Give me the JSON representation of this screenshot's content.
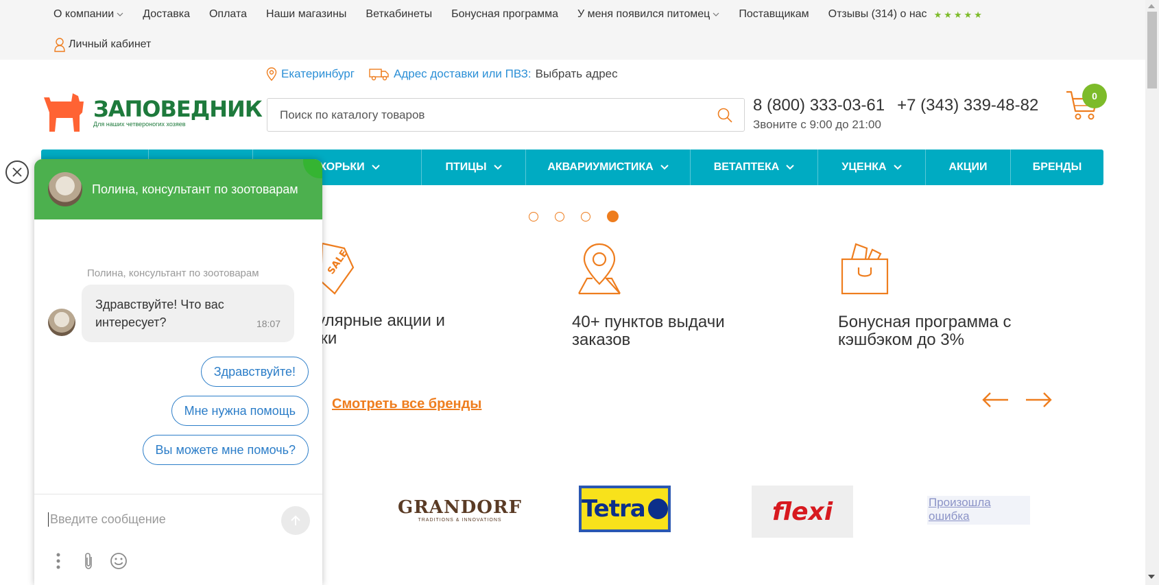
{
  "topnav": {
    "items": [
      {
        "label": "О компании",
        "has_dropdown": true
      },
      {
        "label": "Доставка",
        "has_dropdown": false
      },
      {
        "label": "Оплата",
        "has_dropdown": false
      },
      {
        "label": "Наши магазины",
        "has_dropdown": false
      },
      {
        "label": "Веткабинеты",
        "has_dropdown": false
      },
      {
        "label": "Бонусная программа",
        "has_dropdown": false
      },
      {
        "label": "У меня появился питомец",
        "has_dropdown": true
      },
      {
        "label": "Поставщикам",
        "has_dropdown": false
      },
      {
        "label": "Отзывы (314) о нас",
        "has_dropdown": false
      }
    ],
    "rating_stars": 5,
    "cabinet_label": "Личный кабинет"
  },
  "header": {
    "city": "Екатеринбург",
    "delivery_label": "Адрес доставки или ПВЗ:",
    "delivery_value": "Выбрать адрес",
    "logo_name": "ЗАПОВЕДНИК",
    "logo_tagline": "Для наших четвероногих хозяев",
    "search_placeholder": "Поиск по каталогу товаров",
    "phone_1": "8 (800) 333-03-61",
    "phone_2": "+7 (343) 339-48-82",
    "hours": "Звоните с 9:00 до 21:00",
    "cart_count": "0"
  },
  "categories": [
    {
      "label": "",
      "has_dropdown": false
    },
    {
      "label": "",
      "has_dropdown": false
    },
    {
      "label": "НЫ, ХОРЬКИ",
      "has_dropdown": true
    },
    {
      "label": "ПТИЦЫ",
      "has_dropdown": true
    },
    {
      "label": "АКВАРИУМИСТИКА",
      "has_dropdown": true
    },
    {
      "label": "ВЕТАПТЕКА",
      "has_dropdown": true
    },
    {
      "label": "УЦЕНКА",
      "has_dropdown": true
    },
    {
      "label": "АКЦИИ",
      "has_dropdown": false
    },
    {
      "label": "БРЕНДЫ",
      "has_dropdown": false
    }
  ],
  "slider": {
    "dot_count": 4,
    "active_index": 3
  },
  "features": [
    {
      "icon": "sale-tag-icon",
      "text_line1": "егулярные акции и",
      "text_line2": "идки"
    },
    {
      "icon": "map-pin-icon",
      "text_line1": "40+ пунктов выдачи",
      "text_line2": "заказов"
    },
    {
      "icon": "shopping-bag-icon",
      "text_line1": "Бонусная программа с",
      "text_line2": "кэшбэком до 3%"
    }
  ],
  "brands_section": {
    "see_all_label": "Смотреть все бренды",
    "grandorf_name": "GRANDORF",
    "grandorf_tag": "TRADITIONS & INNOVATIONS",
    "tetra_name": "Tetra",
    "flexi_name": "flexi",
    "error_text": "Произошла ошибка"
  },
  "chat": {
    "header_title": "Полина, консультант по зоотоварам",
    "agent_label": "Полина, консультант по зоотоварам",
    "message_text": "Здравствуйте! Что вас интересует?",
    "message_time": "18:07",
    "quick_replies": [
      "Здравствуйте!",
      "Мне нужна помощь",
      "Вы можете мне помочь?"
    ],
    "input_placeholder": "Введите сообщение"
  },
  "colors": {
    "accent_orange": "#ee7d1e",
    "nav_teal": "#00abc2",
    "chat_green": "#4cb04e",
    "link_blue": "#2b8fd6",
    "logo_green": "#1e7a3c",
    "badge_green": "#7dbb2a"
  }
}
